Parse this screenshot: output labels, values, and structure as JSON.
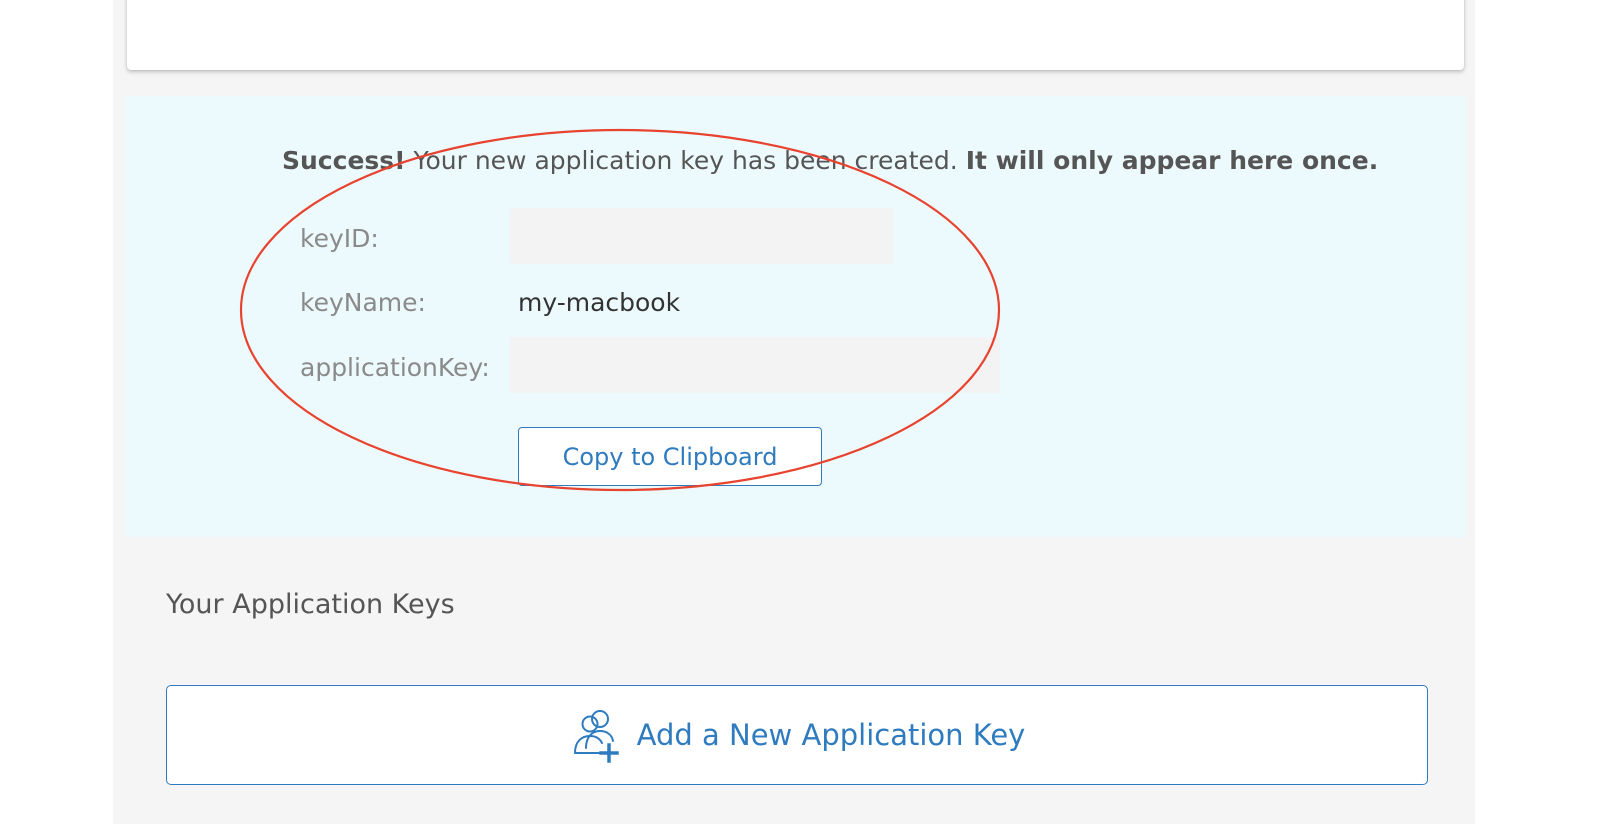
{
  "success_banner": {
    "strong_prefix": "Success!",
    "message": " Your new application key has been created. ",
    "strong_suffix": "It will only appear here once."
  },
  "key_details": {
    "key_id": {
      "label": "keyID:",
      "value": ""
    },
    "key_name": {
      "label": "keyName:",
      "value": "my-macbook"
    },
    "application_key": {
      "label": "applicationKey:",
      "value": ""
    }
  },
  "copy_button_label": "Copy to Clipboard",
  "section_title": "Your Application Keys",
  "add_key_button_label": "Add a New Application Key",
  "icons": {
    "add_user": "add-users-icon"
  },
  "colors": {
    "accent": "#2f7bbf",
    "annotation": "#e8432e",
    "success_background": "#edfafd"
  }
}
